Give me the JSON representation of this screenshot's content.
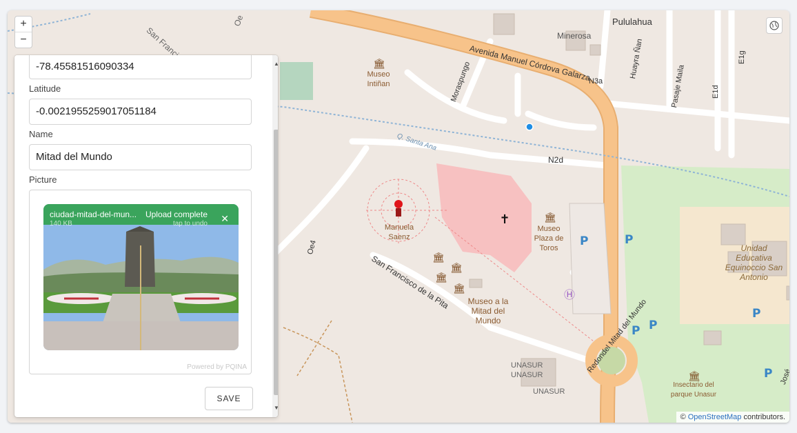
{
  "map": {
    "zoom_in": "+",
    "zoom_out": "−",
    "attribution_prefix": "©",
    "attribution_link": "OpenStreetMap",
    "attribution_suffix": "contributors.",
    "colors": {
      "land": "#f2efe9",
      "road_major": "#f7c38a",
      "road_minor": "#ffffff",
      "park": "#d8f0cc",
      "pink_area": "#f7c1c1"
    }
  },
  "form": {
    "longitude_value": "-78.45581516090334",
    "latitude_label": "Latitude",
    "latitude_value": "-0.0021955259017051184",
    "name_label": "Name",
    "name_value": "Mitad del Mundo",
    "picture_label": "Picture",
    "upload": {
      "file_name": "ciudad-mitad-del-mun...",
      "file_size": "140 KB",
      "status": "Upload complete",
      "hint": "tap to undo",
      "close_icon": "close-icon",
      "powered_by": "Powered by PQINA"
    },
    "save_label": "SAVE"
  },
  "labels": {
    "san_francisco_top": "San Francisco de la Pita",
    "oe_top": "Oe",
    "pululahua": "Pululahua",
    "minerosa": "Minerosa",
    "museo_intinan": "Museo Intiñan",
    "avenida": "Avenida Manuel Córdova Galarza",
    "morasp": "Moraspungo",
    "n3a": "N3a",
    "huayra": "Huayra Ñan",
    "pasaje": "Pasaje Maila",
    "e1d": "E1d",
    "e1g": "E1g",
    "santa_ana": "Q. Santa Ana",
    "n2d": "N2d",
    "manuela": "Manuela Saenz",
    "museo_plaza": "Museo Plaza de Toros",
    "oe4": "Oe4",
    "sf_pita": "San Francisco de la Pita",
    "museo_mitad": "Museo a la Mitad del Mundo",
    "unidad": "Unidad Educativa Equinoccio San Antonio",
    "unasur1": "UNASUR",
    "unasur2": "UNASUR",
    "unasur3": "UNASUR",
    "redondel": "Redondel Mitad del Mundo",
    "insectario": "Insectario del parque Unasur",
    "jose": "José M"
  }
}
